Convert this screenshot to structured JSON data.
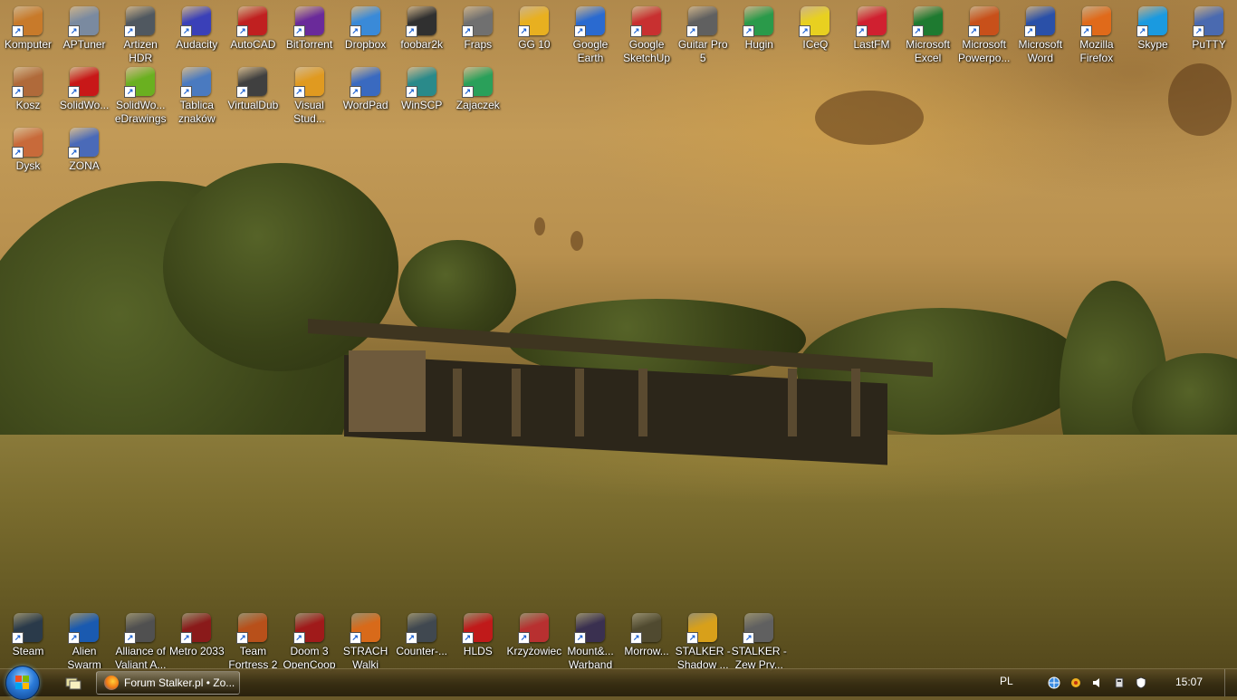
{
  "desktop": {
    "icons": [
      {
        "label": "Komputer",
        "icon": "computer-icon",
        "color": "#c87a2a"
      },
      {
        "label": "APTuner",
        "icon": "aptuner-icon",
        "color": "#7a8aa0"
      },
      {
        "label": "Artizen HDR",
        "icon": "artizen-hdr-icon",
        "color": "#505860"
      },
      {
        "label": "Audacity",
        "icon": "audacity-icon",
        "color": "#3a40b8"
      },
      {
        "label": "AutoCAD",
        "icon": "autocad-icon",
        "color": "#c02020"
      },
      {
        "label": "BitTorrent",
        "icon": "bittorrent-icon",
        "color": "#6a2a9a"
      },
      {
        "label": "Dropbox",
        "icon": "dropbox-icon",
        "color": "#3a8ad8"
      },
      {
        "label": "foobar2k",
        "icon": "foobar2k-icon",
        "color": "#303030"
      },
      {
        "label": "Fraps",
        "icon": "fraps-icon",
        "color": "#707070"
      },
      {
        "label": "GG 10",
        "icon": "gg-icon",
        "color": "#e8b020"
      },
      {
        "label": "Google Earth",
        "icon": "google-earth-icon",
        "color": "#2a6ad0"
      },
      {
        "label": "Google SketchUp",
        "icon": "sketchup-icon",
        "color": "#c83030"
      },
      {
        "label": "Guitar Pro 5",
        "icon": "guitar-pro-icon",
        "color": "#606060"
      },
      {
        "label": "Hugin",
        "icon": "hugin-icon",
        "color": "#2a9a4a"
      },
      {
        "label": "ICeQ",
        "icon": "iceq-icon",
        "color": "#e8d020"
      },
      {
        "label": "LastFM",
        "icon": "lastfm-icon",
        "color": "#d02030"
      },
      {
        "label": "Microsoft Excel",
        "icon": "excel-icon",
        "color": "#1e7a30"
      },
      {
        "label": "Microsoft Powerpo...",
        "icon": "powerpoint-icon",
        "color": "#c8501a"
      },
      {
        "label": "Microsoft Word",
        "icon": "word-icon",
        "color": "#2a50a8"
      },
      {
        "label": "Mozilla Firefox",
        "icon": "firefox-icon",
        "color": "#e06a1a"
      },
      {
        "label": "Skype",
        "icon": "skype-icon",
        "color": "#1a9ae0"
      },
      {
        "label": "PuTTY",
        "icon": "putty-icon",
        "color": "#4a6ab0"
      },
      {
        "label": "Kosz",
        "icon": "recycle-bin-icon",
        "color": "#b06a3a"
      },
      {
        "label": "SolidWo...",
        "icon": "solidworks-icon",
        "color": "#c81818"
      },
      {
        "label": "SolidWo... eDrawings",
        "icon": "edrawings-icon",
        "color": "#6ab020"
      },
      {
        "label": "Tablica znaków",
        "icon": "charmap-icon",
        "color": "#4a7ac0"
      },
      {
        "label": "VirtualDub",
        "icon": "virtualdub-icon",
        "color": "#404040"
      },
      {
        "label": "Visual Stud...",
        "icon": "visual-studio-icon",
        "color": "#e09a20"
      },
      {
        "label": "WordPad",
        "icon": "wordpad-icon",
        "color": "#3a6ac0"
      },
      {
        "label": "WinSCP",
        "icon": "winscp-icon",
        "color": "#2a8a8a"
      },
      {
        "label": "Zajaczek",
        "icon": "zajaczek-icon",
        "color": "#2aa05a"
      },
      {
        "label": "Dysk",
        "icon": "disk-icon",
        "color": "#c86a3a"
      },
      {
        "label": "ZONA",
        "icon": "zona-icon",
        "color": "#4a6ab8"
      },
      {
        "label": "Steam",
        "icon": "steam-icon",
        "color": "#2a3a4a"
      },
      {
        "label": "Alien Swarm",
        "icon": "alien-swarm-icon",
        "color": "#1a5ab0"
      },
      {
        "label": "Alliance of Valiant A...",
        "icon": "alliance-icon",
        "color": "#505050"
      },
      {
        "label": "Metro 2033",
        "icon": "metro-2033-icon",
        "color": "#8a1a1a"
      },
      {
        "label": "Team Fortress 2",
        "icon": "team-fortress-icon",
        "color": "#b8501a"
      },
      {
        "label": "Doom 3 OpenCoop",
        "icon": "doom3-icon",
        "color": "#a01a1a"
      },
      {
        "label": "STRACH Walki",
        "icon": "strach-icon",
        "color": "#d86a1a"
      },
      {
        "label": "Counter-...",
        "icon": "counter-strike-icon",
        "color": "#404850"
      },
      {
        "label": "HLDS",
        "icon": "hlds-icon",
        "color": "#c01a1a"
      },
      {
        "label": "Krzyżowiec",
        "icon": "krzyzowiec-icon",
        "color": "#b83030"
      },
      {
        "label": "Mount&... Warband",
        "icon": "warband-icon",
        "color": "#3a3050"
      },
      {
        "label": "Morrow...",
        "icon": "morrowind-icon",
        "color": "#504a30"
      },
      {
        "label": "STALKER - Shadow ...",
        "icon": "stalker-shadow-icon",
        "color": "#d8a01a"
      },
      {
        "label": "STALKER - Zew Pry...",
        "icon": "stalker-zew-icon",
        "color": "#606060"
      }
    ]
  },
  "taskbar": {
    "start_icon": "windows-start-icon",
    "quick_launch_icon": "show-desktop-icon",
    "active_window": {
      "label": "Forum Stalker.pl • Zo...",
      "icon": "firefox-icon"
    },
    "language": "PL",
    "tray_icons": [
      "network-globe-icon",
      "gg-status-icon",
      "volume-icon",
      "safely-remove-icon",
      "shield-icon"
    ],
    "clock": "15:07"
  }
}
